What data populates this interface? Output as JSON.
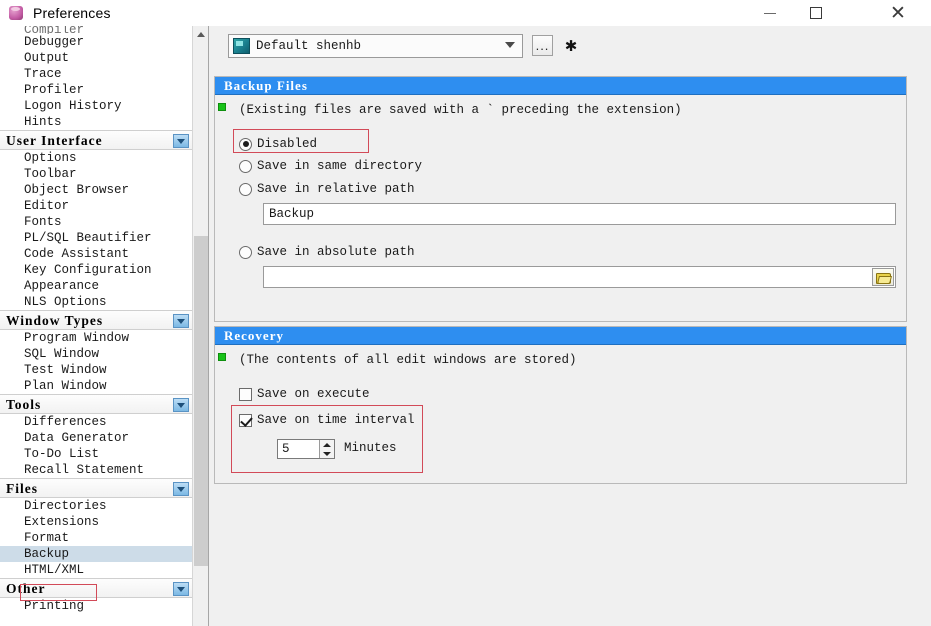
{
  "window": {
    "title": "Preferences",
    "icon": "database-icon",
    "controls": {
      "minimize": "minimize-icon",
      "maximize": "maximize-icon",
      "close": "close-icon"
    }
  },
  "profile": {
    "selected": "Default shenhb",
    "icon": "profile-icon",
    "more_label": "...",
    "star_label": "✱"
  },
  "sidebar": {
    "nodes": [
      {
        "type": "item",
        "label": "Compiler",
        "clipped": true,
        "selected": false
      },
      {
        "type": "item",
        "label": "Debugger",
        "selected": false
      },
      {
        "type": "item",
        "label": "Output",
        "selected": false
      },
      {
        "type": "item",
        "label": "Trace",
        "selected": false
      },
      {
        "type": "item",
        "label": "Profiler",
        "selected": false
      },
      {
        "type": "item",
        "label": "Logon History",
        "selected": false
      },
      {
        "type": "item",
        "label": "Hints",
        "selected": false
      },
      {
        "type": "category",
        "label": "User Interface"
      },
      {
        "type": "item",
        "label": "Options",
        "selected": false
      },
      {
        "type": "item",
        "label": "Toolbar",
        "selected": false
      },
      {
        "type": "item",
        "label": "Object Browser",
        "selected": false
      },
      {
        "type": "item",
        "label": "Editor",
        "selected": false
      },
      {
        "type": "item",
        "label": "Fonts",
        "selected": false
      },
      {
        "type": "item",
        "label": "PL/SQL Beautifier",
        "selected": false
      },
      {
        "type": "item",
        "label": "Code Assistant",
        "selected": false
      },
      {
        "type": "item",
        "label": "Key Configuration",
        "selected": false
      },
      {
        "type": "item",
        "label": "Appearance",
        "selected": false
      },
      {
        "type": "item",
        "label": "NLS Options",
        "selected": false
      },
      {
        "type": "category",
        "label": "Window Types"
      },
      {
        "type": "item",
        "label": "Program Window",
        "selected": false
      },
      {
        "type": "item",
        "label": "SQL Window",
        "selected": false
      },
      {
        "type": "item",
        "label": "Test Window",
        "selected": false
      },
      {
        "type": "item",
        "label": "Plan Window",
        "selected": false
      },
      {
        "type": "category",
        "label": "Tools"
      },
      {
        "type": "item",
        "label": "Differences",
        "selected": false
      },
      {
        "type": "item",
        "label": "Data Generator",
        "selected": false
      },
      {
        "type": "item",
        "label": "To-Do List",
        "selected": false
      },
      {
        "type": "item",
        "label": "Recall Statement",
        "selected": false
      },
      {
        "type": "category",
        "label": "Files"
      },
      {
        "type": "item",
        "label": "Directories",
        "selected": false
      },
      {
        "type": "item",
        "label": "Extensions",
        "selected": false
      },
      {
        "type": "item",
        "label": "Format",
        "selected": false
      },
      {
        "type": "item",
        "label": "Backup",
        "selected": true
      },
      {
        "type": "item",
        "label": "HTML/XML",
        "selected": false
      },
      {
        "type": "category",
        "label": "Other"
      },
      {
        "type": "item",
        "label": "Printing",
        "selected": false
      }
    ]
  },
  "backup_files": {
    "header": "Backup Files",
    "hint": "(Existing files are saved with a ` preceding the extension)",
    "options": [
      {
        "label": "Disabled",
        "selected": true
      },
      {
        "label": "Save in same directory",
        "selected": false
      },
      {
        "label": "Save in relative path",
        "selected": false
      },
      {
        "label": "Save in absolute path",
        "selected": false
      }
    ],
    "relative_path_value": "Backup",
    "absolute_path_value": "",
    "browse_icon": "folder-open-icon"
  },
  "recovery": {
    "header": "Recovery",
    "hint": "(The contents of all edit windows are stored)",
    "save_on_execute": {
      "label": "Save on execute",
      "checked": false
    },
    "save_on_interval": {
      "label": "Save on time interval",
      "checked": true
    },
    "interval_value": "5",
    "interval_unit": "Minutes"
  },
  "annotations": {
    "color": "#d24a58",
    "boxes": [
      "backup-sidebar-item",
      "disabled-radio-option",
      "save-on-time-interval-group"
    ]
  }
}
